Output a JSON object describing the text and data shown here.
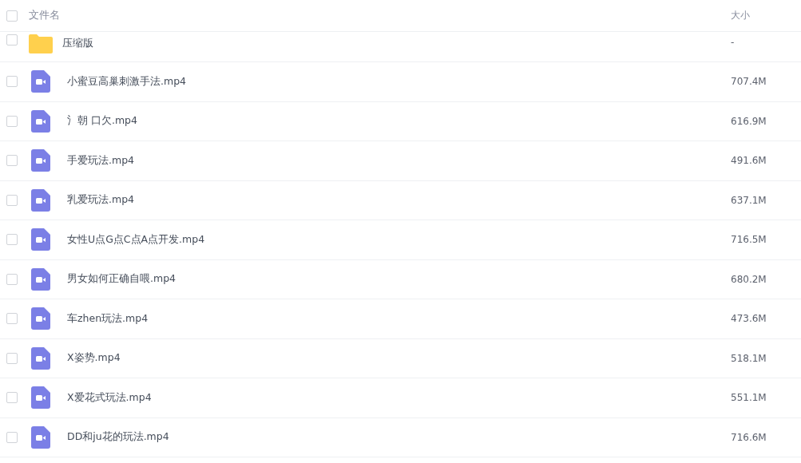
{
  "header": {
    "checked": false,
    "name_label": "文件名",
    "size_label": "大小"
  },
  "files": [
    {
      "kind": "folder",
      "name": "压缩版",
      "size": "-",
      "checked": false
    },
    {
      "kind": "video",
      "name": "小蜜豆高巢刺激手法.mp4",
      "size": "707.4M",
      "checked": false
    },
    {
      "kind": "video",
      "name": "氵朝 口欠.mp4",
      "size": "616.9M",
      "checked": false
    },
    {
      "kind": "video",
      "name": "手爱玩法.mp4",
      "size": "491.6M",
      "checked": false
    },
    {
      "kind": "video",
      "name": "乳爱玩法.mp4",
      "size": "637.1M",
      "checked": false
    },
    {
      "kind": "video",
      "name": "女性U点G点C点A点开发.mp4",
      "size": "716.5M",
      "checked": false
    },
    {
      "kind": "video",
      "name": "男女如何正确自喂.mp4",
      "size": "680.2M",
      "checked": false
    },
    {
      "kind": "video",
      "name": "车zhen玩法.mp4",
      "size": "473.6M",
      "checked": false
    },
    {
      "kind": "video",
      "name": "X姿势.mp4",
      "size": "518.1M",
      "checked": false
    },
    {
      "kind": "video",
      "name": "X爱花式玩法.mp4",
      "size": "551.1M",
      "checked": false
    },
    {
      "kind": "video",
      "name": "DD和ju花的玩法.mp4",
      "size": "716.6M",
      "checked": false
    }
  ]
}
